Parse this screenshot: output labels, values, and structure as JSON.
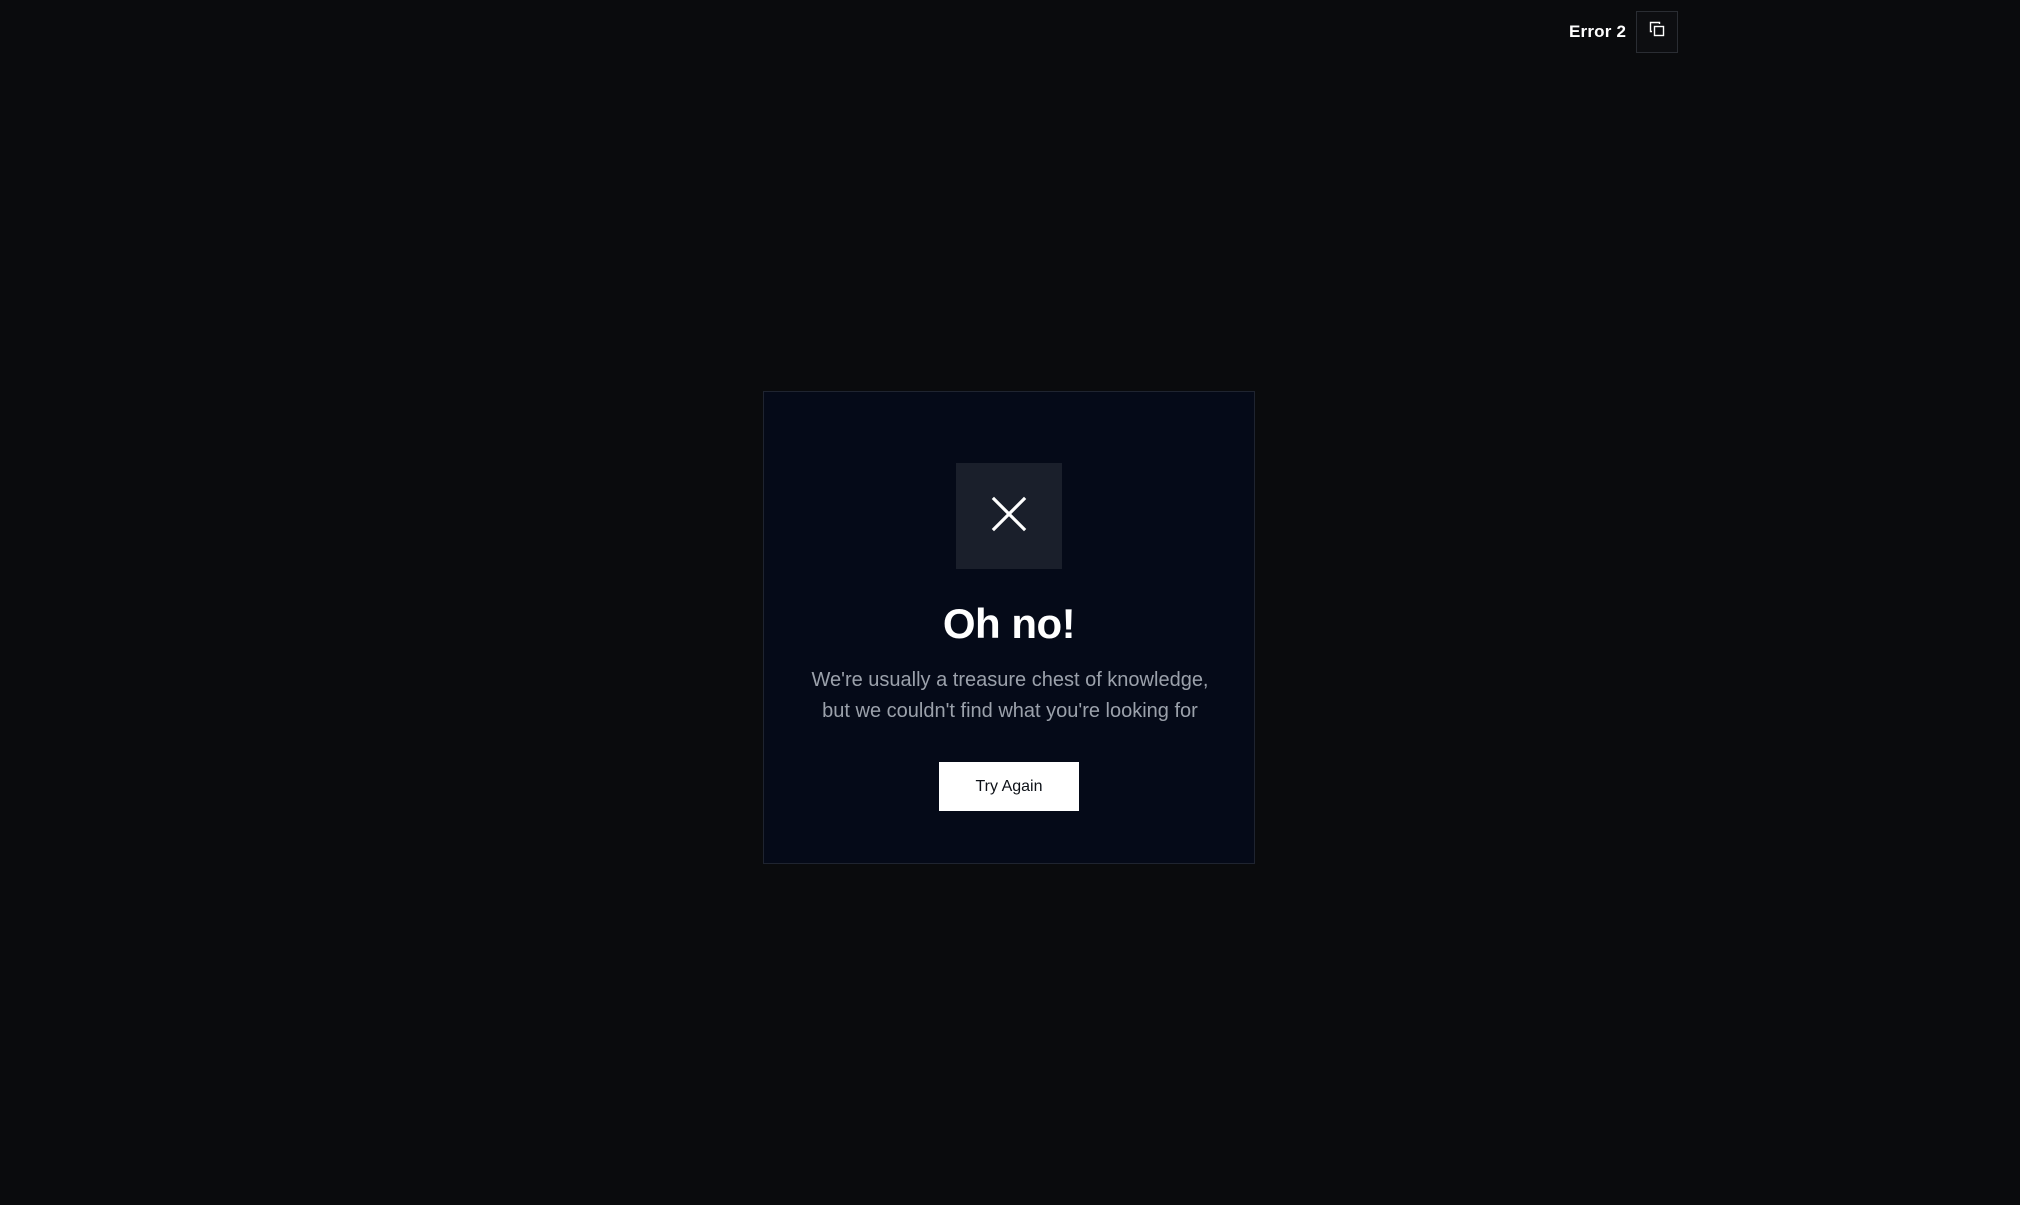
{
  "error": {
    "label": "Error 2",
    "copy_icon": "copy-icon"
  },
  "card": {
    "icon": "close-icon",
    "title": "Oh no!",
    "message_line_1": "We're usually a treasure chest of knowledge,",
    "message_line_2": "but we couldn't find what you're looking for",
    "button_label": "Try Again"
  },
  "colors": {
    "background": "#0a0b0d",
    "card_background": "#050a18",
    "icon_box": "#1a1f2b",
    "button": "#ffffff",
    "message_text": "#9ba1ab"
  }
}
